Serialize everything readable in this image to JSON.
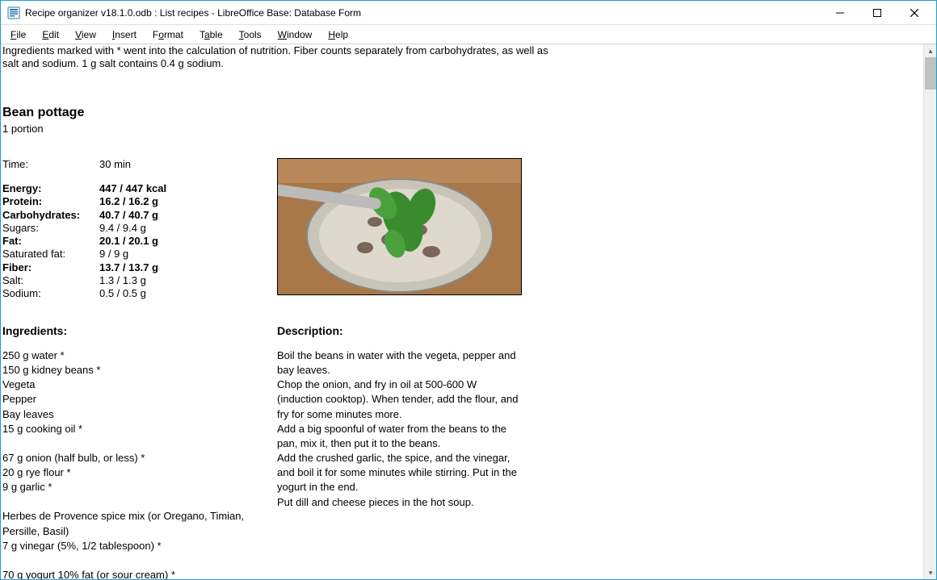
{
  "window": {
    "title": "Recipe organizer v18.1.0.odb : List recipes - LibreOffice Base: Database Form"
  },
  "menu": {
    "file": "File",
    "edit": "Edit",
    "view": "View",
    "insert": "Insert",
    "format": "Format",
    "table": "Table",
    "tools": "Tools",
    "window": "Window",
    "help": "Help"
  },
  "note": {
    "line1": "Ingredients marked with * went into the calculation of nutrition. Fiber counts separately from carbohydrates, as well as",
    "line2": "salt and sodium. 1 g salt contains 0.4 g sodium."
  },
  "recipe": {
    "title": "Bean pottage",
    "portion": "1 portion",
    "time_label": "Time:",
    "time_value": "30 min",
    "nutrition": [
      {
        "label": "Energy:",
        "value": "447 / 447 kcal",
        "bold": true
      },
      {
        "label": "Protein:",
        "value": "16.2 / 16.2 g",
        "bold": true
      },
      {
        "label": "Carbohydrates:",
        "value": "40.7 / 40.7 g",
        "bold": true
      },
      {
        "label": "Sugars:",
        "value": "9.4 / 9.4 g",
        "bold": false
      },
      {
        "label": "Fat:",
        "value": "20.1 / 20.1 g",
        "bold": true
      },
      {
        "label": "Saturated fat:",
        "value": "9 / 9 g",
        "bold": false
      },
      {
        "label": "Fiber:",
        "value": "13.7 / 13.7 g",
        "bold": true
      },
      {
        "label": "Salt:",
        "value": "1.3 / 1.3 g",
        "bold": false
      },
      {
        "label": "Sodium:",
        "value": "0.5 / 0.5 g",
        "bold": false
      }
    ],
    "ingredients_heading": "Ingredients:",
    "description_heading": "Description:",
    "ingredients": [
      "250 g water *",
      "150 g kidney beans *",
      "Vegeta",
      "Pepper",
      "Bay leaves",
      "15 g cooking oil *",
      "",
      "67 g onion (half bulb, or less) *",
      "20 g rye flour *",
      "9 g garlic *",
      "",
      "Herbes de Provence spice mix (or Oregano, Timian, Persille, Basil)",
      "7 g vinegar (5%, 1/2 tablespoon) *",
      "",
      "70 g yogurt 10% fat (or sour cream) *"
    ],
    "description": [
      "Boil the beans in water with the vegeta, pepper and bay leaves.",
      "Chop the onion, and fry in oil at 500-600 W (induction cooktop). When tender, add the flour, and fry for some minutes more.",
      "Add a big spoonful of water from the beans to the pan, mix it, then put it to the beans.",
      "Add the crushed garlic, the spice, and the vinegar, and boil it for some minutes while stirring. Put in the yogurt in the end.",
      "Put dill and cheese pieces in the hot soup."
    ]
  }
}
